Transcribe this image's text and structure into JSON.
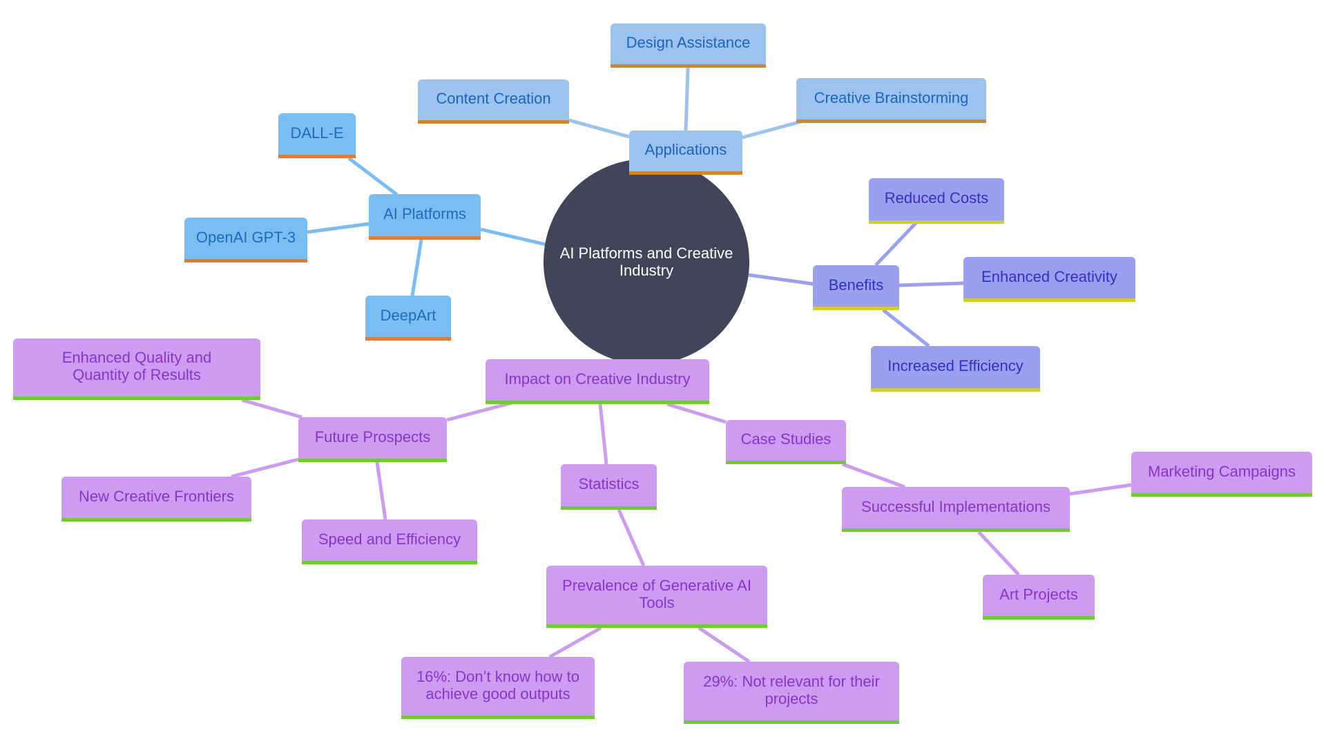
{
  "root": {
    "label": "AI Platforms and Creative Industry"
  },
  "branches": {
    "ai_platforms": {
      "label": "AI Platforms",
      "children": [
        "DALL-E",
        "OpenAI GPT-3",
        "DeepArt"
      ]
    },
    "applications": {
      "label": "Applications",
      "children": [
        "Content Creation",
        "Design Assistance",
        "Creative Brainstorming"
      ]
    },
    "benefits": {
      "label": "Benefits",
      "children": [
        "Reduced Costs",
        "Enhanced Creativity",
        "Increased Efficiency"
      ]
    },
    "impact": {
      "label": "Impact on Creative Industry",
      "future_prospects": {
        "label": "Future Prospects",
        "children": [
          "Enhanced Quality and Quantity of Results",
          "New Creative Frontiers",
          "Speed and Efficiency"
        ]
      },
      "statistics": {
        "label": "Statistics",
        "prevalence": {
          "label": "Prevalence of Generative AI Tools",
          "children": [
            "16%: Don’t know how to achieve good outputs",
            "29%: Not relevant for their projects"
          ]
        }
      },
      "case_studies": {
        "label": "Case Studies",
        "successful_implementations": {
          "label": "Successful Implementations",
          "children": [
            "Marketing Campaigns",
            "Art Projects"
          ]
        }
      }
    }
  },
  "colors": {
    "root": "#404559",
    "ai_platforms": "#7bbdf0",
    "applications": "#9cc3ee",
    "benefits": "#9aa0f0",
    "impact": "#cd9cf0",
    "edge_platforms": "#7bbdf0",
    "edge_apps": "#9cc3ee",
    "edge_benefits": "#9aa0f0",
    "edge_impact": "#cd9cf0"
  }
}
